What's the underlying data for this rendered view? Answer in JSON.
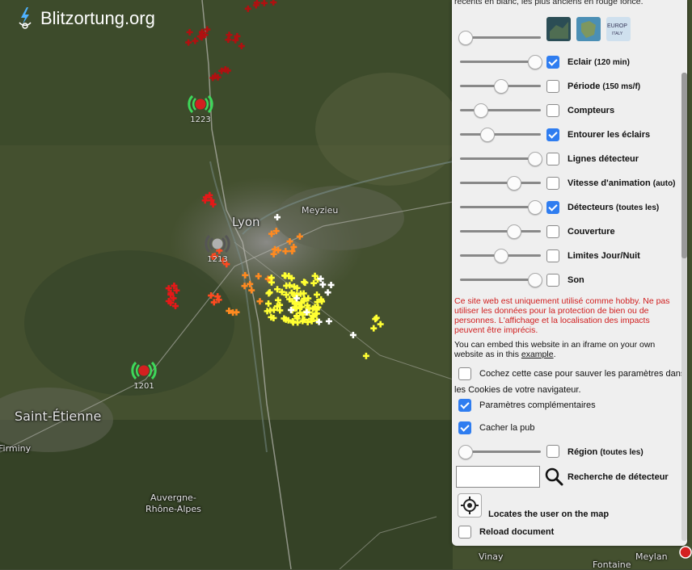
{
  "brand": {
    "name": "Blitzortung.org"
  },
  "map": {
    "labels": {
      "lyon": "Lyon",
      "meyzieu": "Meyzieu",
      "saint_etienne": "Saint-Étienne",
      "firminy": "Firminy",
      "region_line1": "Auvergne-",
      "region_line2": "Rhône-Alpes",
      "vinay": "Vinay",
      "fontaine": "Fontaine",
      "meylan": "Meylan"
    },
    "stations": [
      {
        "code": "1223",
        "status": "active",
        "color": "#d42020"
      },
      {
        "code": "1213",
        "status": "inactive",
        "color": "#b0b0b0"
      },
      {
        "code": "1201",
        "status": "active",
        "color": "#d42020"
      }
    ],
    "strike_colors": [
      "#ffffff",
      "#ffff33",
      "#ffc020",
      "#ff8a20",
      "#ff4a20",
      "#e61818",
      "#b01010"
    ]
  },
  "panel": {
    "top_text": "récents en blanc, les plus anciens en rouge foncé.",
    "map_thumbs": [
      "Satellite",
      "Europe",
      "EUROPE ITALY"
    ],
    "settings": [
      {
        "label": "Eclair",
        "hint": "(120 min)",
        "checked": true,
        "slider": 0.92
      },
      {
        "label": "Période",
        "hint": "(150 ms/f)",
        "checked": false,
        "slider": 0.5
      },
      {
        "label": "Compteurs",
        "hint": "",
        "checked": false,
        "slider": 0.25
      },
      {
        "label": "Entourer les éclairs",
        "hint": "",
        "checked": true,
        "slider": 0.33
      },
      {
        "label": "Lignes détecteur",
        "hint": "",
        "checked": false,
        "slider": 0.92
      },
      {
        "label": "Vitesse d'animation",
        "hint": "(auto)",
        "checked": false,
        "slider": 0.66
      },
      {
        "label": "Détecteurs",
        "hint": "(toutes les)",
        "checked": true,
        "slider": 0.92
      },
      {
        "label": "Couverture",
        "hint": "",
        "checked": false,
        "slider": 0.66
      },
      {
        "label": "Limites Jour/Nuit",
        "hint": "",
        "checked": false,
        "slider": 0.5
      },
      {
        "label": "Son",
        "hint": "",
        "checked": false,
        "slider": 0.92
      }
    ],
    "warning": "Ce site web est uniquement utilisé comme hobby. Ne pas utiliser les données pour la protection de bien ou de personnes. L'affichage et la localisation des impacts peuvent être imprécis.",
    "embed_text": "You can embed this website in an iframe on your own website as in this ",
    "embed_link": "example",
    "embed_end": ".",
    "cookie_label": "Cochez cette case pour sauver les paramètres dans",
    "cookie_label2": "les Cookies de votre navigateur.",
    "cookie_checked": false,
    "advanced_label": "Paramètres complémentaires",
    "advanced_checked": true,
    "hide_ad_label": "Cacher la pub",
    "hide_ad_checked": true,
    "region_label": "Région",
    "region_hint": "(toutes les)",
    "region_slider": 0.06,
    "detector_search_label": "Recherche de détecteur",
    "detector_search_value": "",
    "locate_label": "Locates the user on the map",
    "reload_label": "Reload document"
  }
}
